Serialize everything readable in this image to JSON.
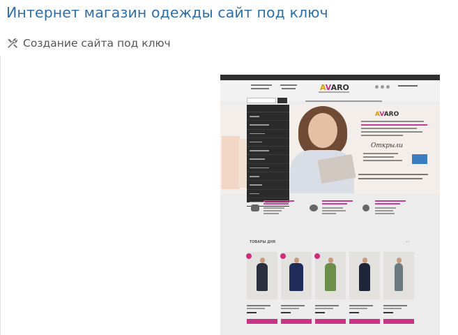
{
  "page": {
    "title": "Интернет магазин одежды сайт под ключ",
    "category_label": "Создание сайта под ключ",
    "category_icon": "tools-icon"
  },
  "screenshot": {
    "logo": {
      "text_a": "A",
      "text_rest_1": "V",
      "text_rest_2": "ARO"
    },
    "hero_open_text": "Открыли",
    "section_title": "ТОВАРЫ ДНЯ",
    "arrows": "‹  ›"
  },
  "colors": {
    "title": "#2d6fa8",
    "brand_pink": "#c93287",
    "brand_gold": "#d19b10",
    "menu_bg": "#2b2b2b"
  }
}
